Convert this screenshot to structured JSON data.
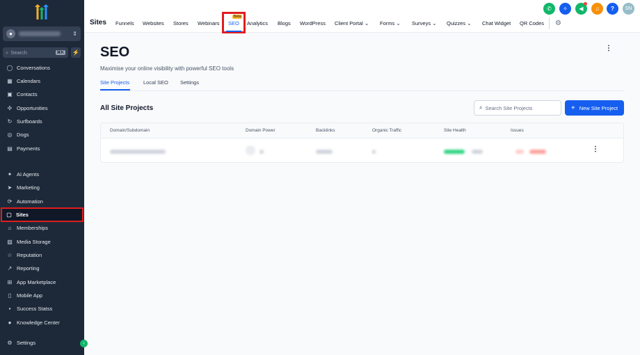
{
  "sidebar": {
    "search_placeholder": "Search",
    "search_shortcut": "⌘K",
    "items": [
      {
        "label": "Conversations",
        "icon": "chat-icon"
      },
      {
        "label": "Calendars",
        "icon": "calendar-icon"
      },
      {
        "label": "Contacts",
        "icon": "contacts-icon"
      },
      {
        "label": "Opportunities",
        "icon": "opportunities-icon"
      },
      {
        "label": "Surfboards",
        "icon": "surfboard-icon"
      },
      {
        "label": "Dogs",
        "icon": "dog-icon"
      },
      {
        "label": "Payments",
        "icon": "payments-icon"
      },
      {
        "label": "AI Agents",
        "icon": "sparkle-icon"
      },
      {
        "label": "Marketing",
        "icon": "send-icon"
      },
      {
        "label": "Automation",
        "icon": "automation-icon"
      },
      {
        "label": "Sites",
        "icon": "sites-icon"
      },
      {
        "label": "Memberships",
        "icon": "memberships-icon"
      },
      {
        "label": "Media Storage",
        "icon": "media-icon"
      },
      {
        "label": "Reputation",
        "icon": "star-icon"
      },
      {
        "label": "Reporting",
        "icon": "reporting-icon"
      },
      {
        "label": "App Marketplace",
        "icon": "marketplace-icon"
      },
      {
        "label": "Mobile App",
        "icon": "mobile-icon"
      },
      {
        "label": "Success Statss",
        "icon": "stats-icon"
      },
      {
        "label": "Knowledge Center",
        "icon": "info-icon"
      },
      {
        "label": "Settings",
        "icon": "gear-icon"
      }
    ]
  },
  "topbar": {
    "title": "Sites",
    "tabs": [
      "Funnels",
      "Websites",
      "Stores",
      "Webinars",
      "SEO",
      "Analytics",
      "Blogs",
      "WordPress",
      "Client Portal",
      "Forms",
      "Surveys",
      "Quizzes",
      "Chat Widget",
      "QR Codes"
    ],
    "beta_badge": "Beta",
    "avatar_initials": "SN",
    "help_label": "?"
  },
  "main": {
    "title": "SEO",
    "subtitle": "Maximise your online visibility with powerful SEO tools",
    "subtabs": [
      "Site Projects",
      "Local SEO",
      "Settings"
    ],
    "section_title": "All Site Projects",
    "search_placeholder": "Search Site Projects",
    "new_button": "New Site Project",
    "columns": [
      "Domain/Subdomain",
      "Domain Power",
      "Backlinks",
      "Organic Traffic",
      "Site Health",
      "Issues"
    ]
  },
  "colors": {
    "sidebar_bg": "#1d2939",
    "accent": "#155eef",
    "highlight": "#e11d1d",
    "beta": "#fdb022"
  }
}
